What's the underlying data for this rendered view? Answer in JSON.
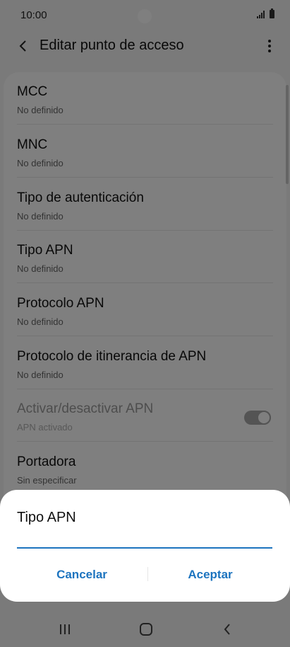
{
  "status_bar": {
    "time": "10:00"
  },
  "app_bar": {
    "title": "Editar punto de acceso"
  },
  "settings": [
    {
      "label": "MCC",
      "value": "No definido"
    },
    {
      "label": "MNC",
      "value": "No definido"
    },
    {
      "label": "Tipo de autenticación",
      "value": "No definido"
    },
    {
      "label": "Tipo APN",
      "value": "No definido"
    },
    {
      "label": "Protocolo APN",
      "value": "No definido"
    },
    {
      "label": "Protocolo de itinerancia de APN",
      "value": "No definido"
    },
    {
      "label": "Activar/desactivar APN",
      "value": "APN activado",
      "toggle": true,
      "disabled": true
    },
    {
      "label": "Portadora",
      "value": "Sin especificar"
    }
  ],
  "dialog": {
    "title": "Tipo APN",
    "input_value": "",
    "cancel_label": "Cancelar",
    "accept_label": "Aceptar"
  },
  "colors": {
    "accent": "#1d74bf",
    "scrim": "#7b7b7b"
  },
  "icons": {
    "back": "chevron-left-icon",
    "menu": "more-vertical-icon",
    "nav_recent": "recent-apps-icon",
    "nav_home": "home-icon",
    "nav_back": "back-icon"
  }
}
